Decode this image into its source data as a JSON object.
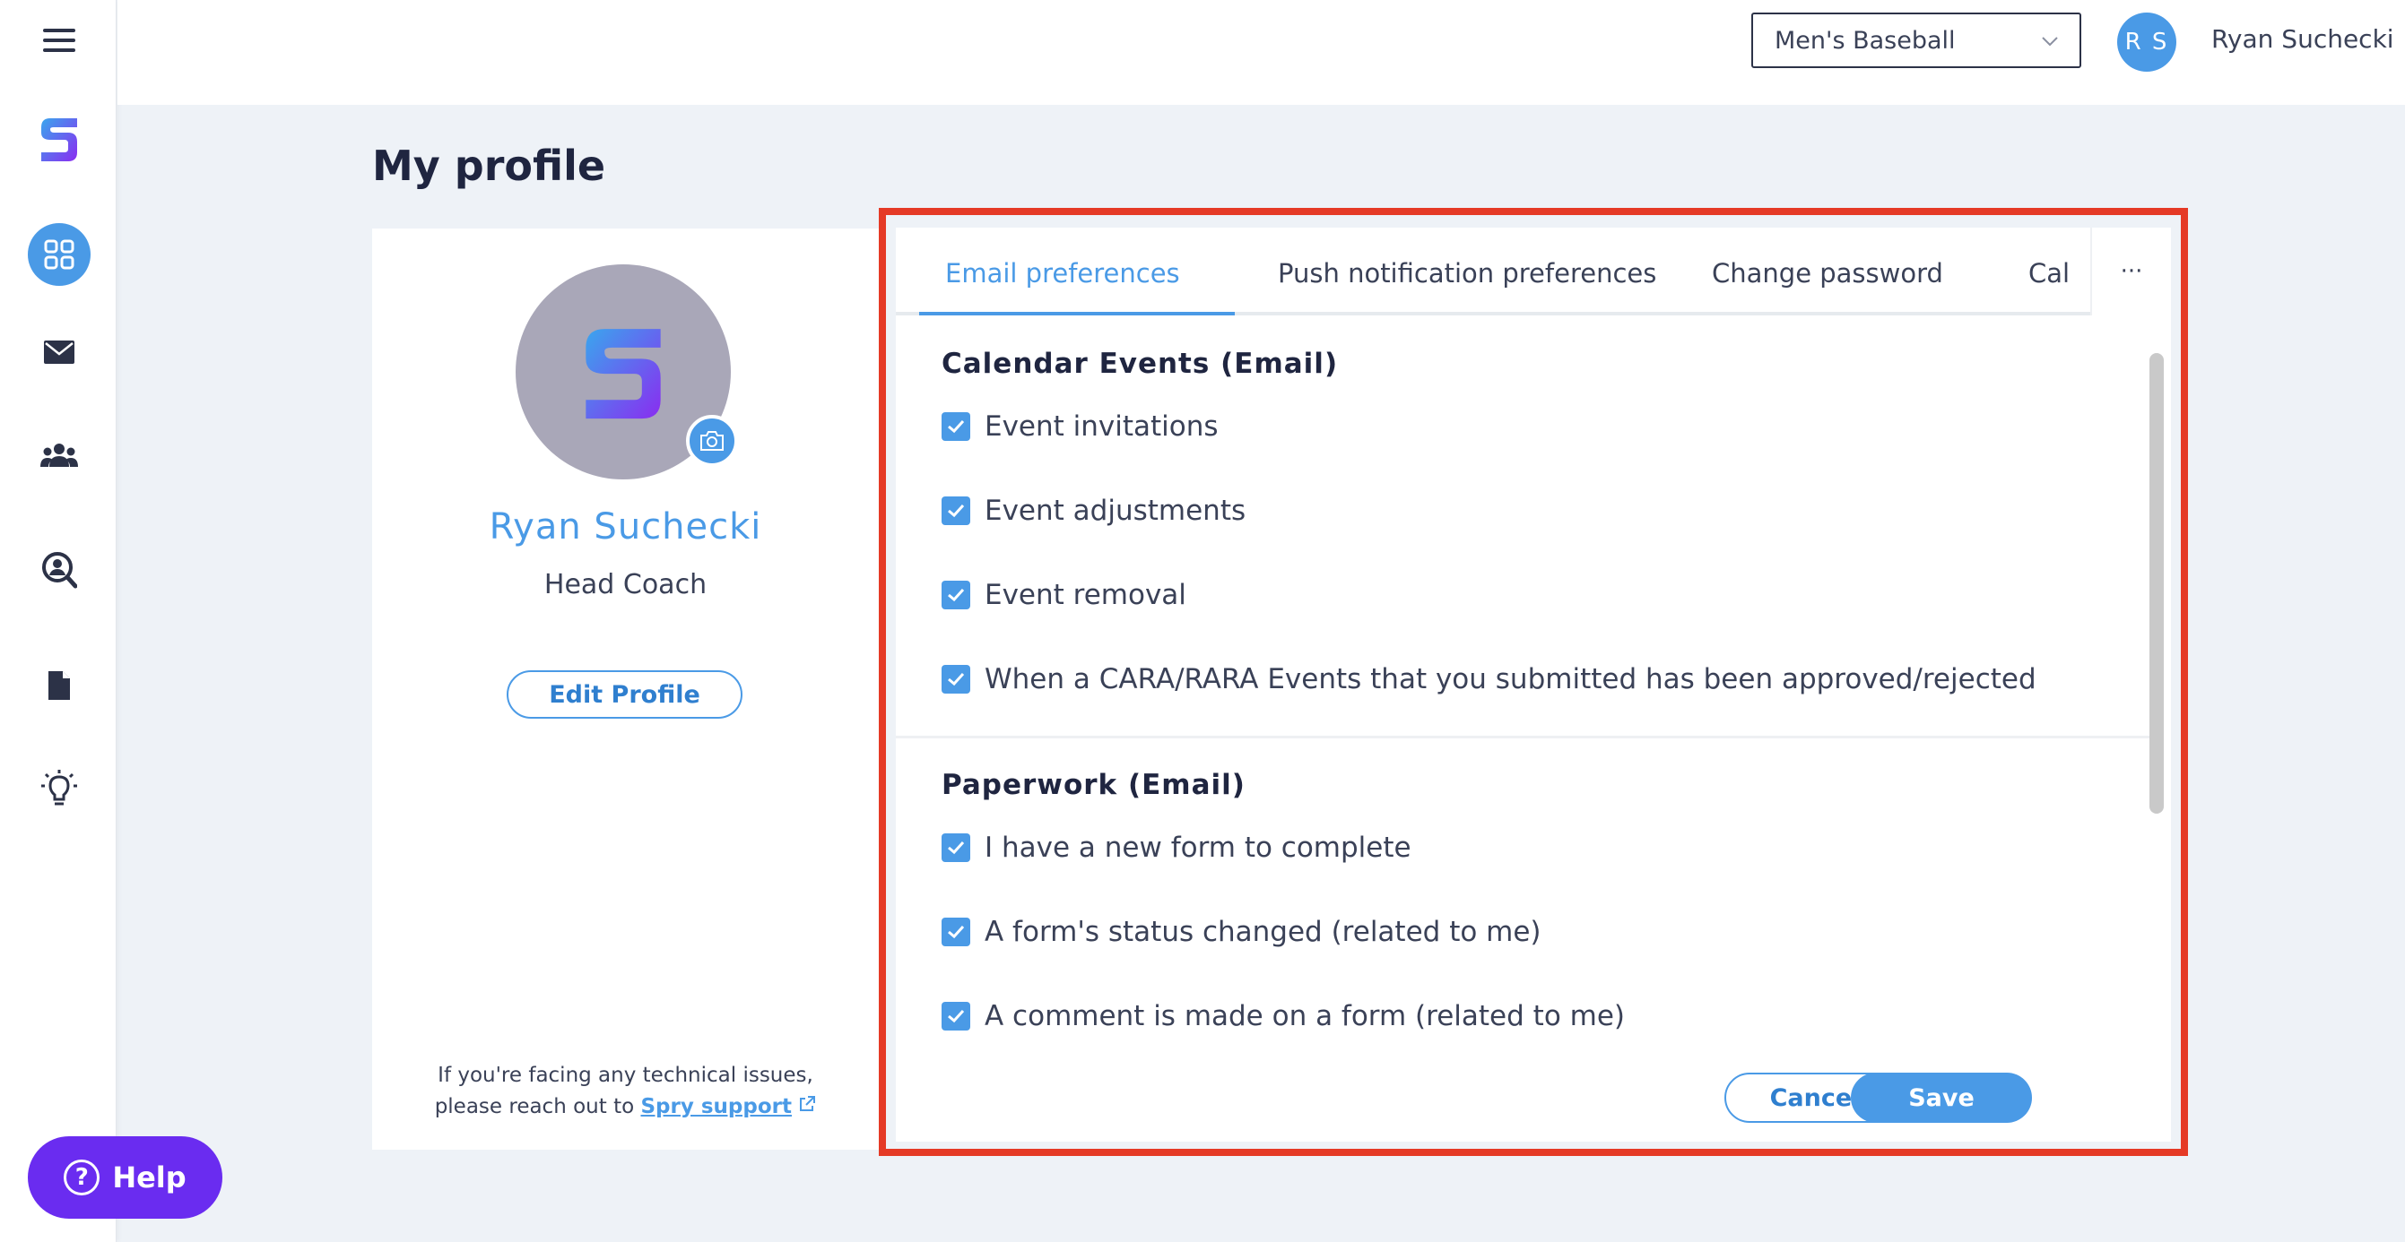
{
  "sidebar": {
    "menu_icon": "hamburger-icon",
    "logo_icon": "spry-logo",
    "items": [
      {
        "name": "dashboard",
        "icon": "grid-icon",
        "active": true
      },
      {
        "name": "messages",
        "icon": "envelope-icon"
      },
      {
        "name": "team",
        "icon": "people-icon"
      },
      {
        "name": "recruiting",
        "icon": "person-search-icon"
      },
      {
        "name": "paperwork",
        "icon": "document-icon"
      },
      {
        "name": "ideas",
        "icon": "lightbulb-icon"
      }
    ]
  },
  "topbar": {
    "team_select": "Men's Baseball",
    "avatar_initials": "R S",
    "user_name": "Ryan Suchecki"
  },
  "page": {
    "title": "My profile"
  },
  "profile": {
    "name": "Ryan Suchecki",
    "role": "Head Coach",
    "edit_label": "Edit Profile",
    "support_line1": "If you're facing any technical issues,",
    "support_line2": "please reach out to",
    "support_link": "Spry support"
  },
  "tabs": [
    {
      "label": "Email preferences",
      "active": true
    },
    {
      "label": "Push notification preferences"
    },
    {
      "label": "Change password"
    },
    {
      "label": "Cal"
    }
  ],
  "more_label": "···",
  "sections": [
    {
      "title": "Calendar Events (Email)",
      "items": [
        {
          "label": "Event invitations",
          "checked": true
        },
        {
          "label": "Event adjustments",
          "checked": true
        },
        {
          "label": "Event removal",
          "checked": true
        },
        {
          "label": "When a CARA/RARA Events that you submitted has been approved/rejected",
          "checked": true
        }
      ]
    },
    {
      "title": "Paperwork (Email)",
      "items": [
        {
          "label": "I have a new form to complete",
          "checked": true
        },
        {
          "label": "A form's status changed (related to me)",
          "checked": true
        },
        {
          "label": "A comment is made on a form (related to me)",
          "checked": true
        }
      ]
    }
  ],
  "actions": {
    "cancel": "Cancel",
    "save": "Save"
  },
  "help": {
    "label": "Help"
  },
  "colors": {
    "accent": "#4a9ae6",
    "highlight_border": "#e53a26",
    "help_purple": "#6a2cf0",
    "text_dark": "#1f2540"
  }
}
